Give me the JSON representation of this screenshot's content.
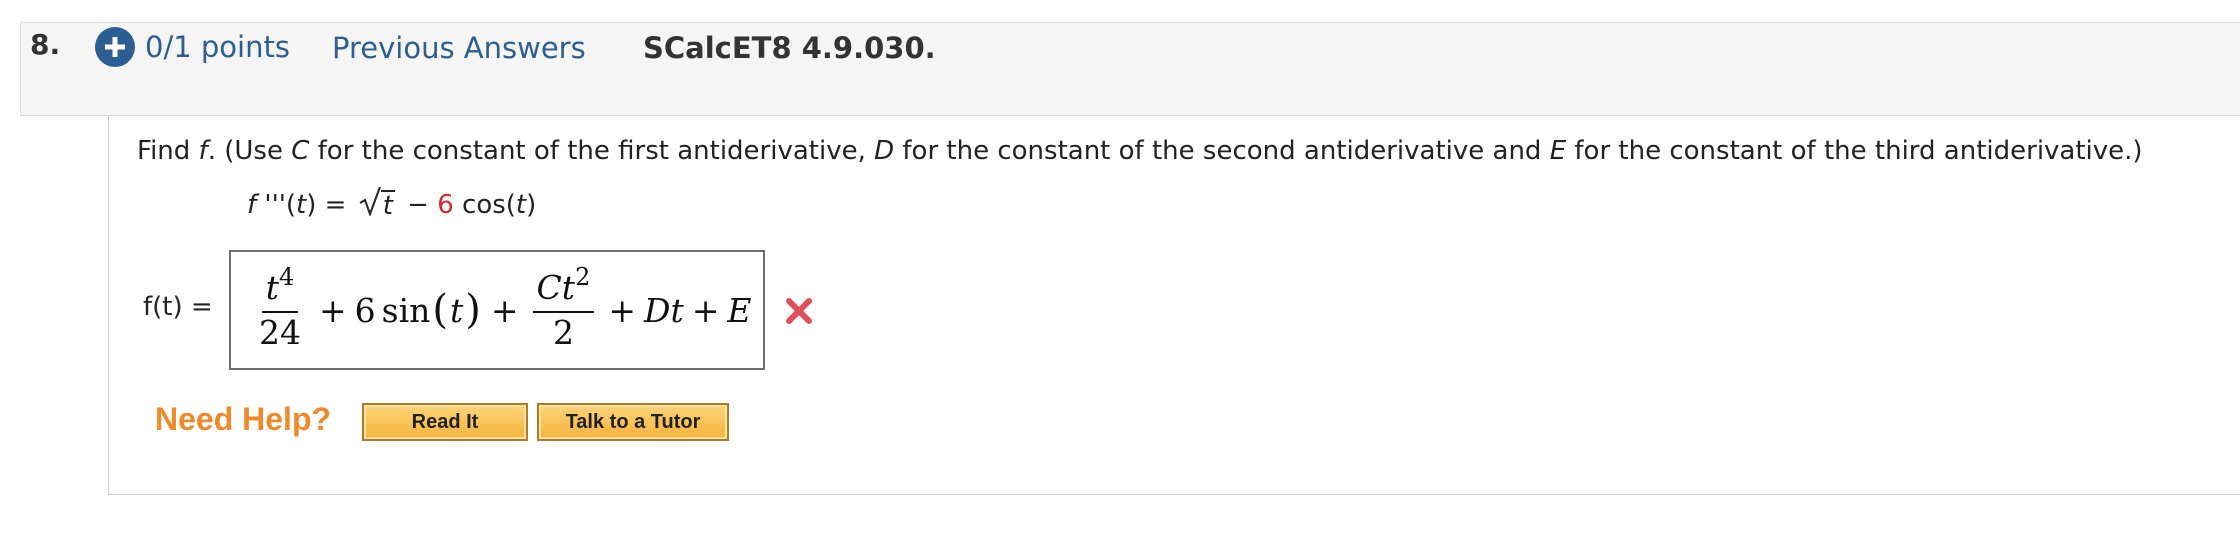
{
  "question": {
    "number": "8.",
    "points": "0/1 points",
    "previous_answers": "Previous Answers",
    "source": "SCalcET8 4.9.030."
  },
  "instruction": {
    "part1": "Find ",
    "f": "f",
    "part2": ". (Use ",
    "C": "C",
    "part3": " for the constant of the first antiderivative, ",
    "D": "D",
    "part4": " for the constant of the second antiderivative and ",
    "E": "E",
    "part5": " for the constant of the third antiderivative.)"
  },
  "given": {
    "lhs_f": "f",
    "lhs_primes": " '''(",
    "lhs_t": "t",
    "lhs_close": ") = ",
    "sqrt_arg": "t",
    "minus": " − ",
    "coef": "6",
    "func": " cos(",
    "func_t": "t",
    "func_close": ")"
  },
  "answer": {
    "label": "f(t) =",
    "t": "t",
    "exp4": "4",
    "den24": "24",
    "plus": "+",
    "six": "6",
    "sin": "sin",
    "lparen": "(",
    "rparen": ")",
    "C": "C",
    "exp2": "2",
    "den2": "2",
    "D": "D",
    "E": "E"
  },
  "status": {
    "result": "incorrect",
    "color": "#e0505a"
  },
  "help": {
    "title": "Need Help?",
    "read_it": "Read It",
    "tutor": "Talk to a Tutor"
  },
  "colors": {
    "link": "#2c5e93",
    "help_orange": "#ef8a2a",
    "coef_red": "#d42a2a"
  }
}
